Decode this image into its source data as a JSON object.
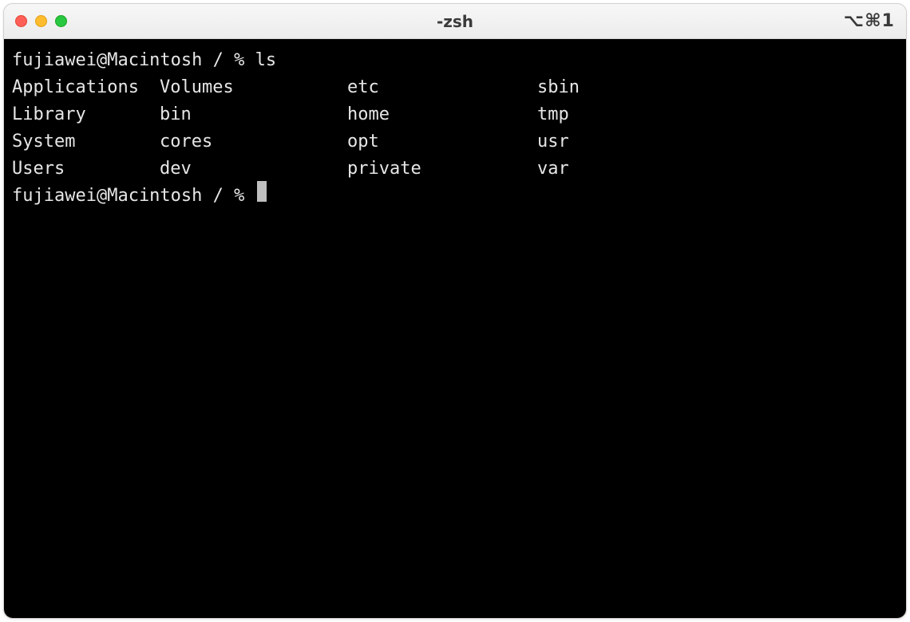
{
  "window": {
    "title": "-zsh",
    "shortcut_indicator": "⌥⌘1"
  },
  "terminal": {
    "prompt_1": "fujiawei@Macintosh / % ",
    "command_1": "ls",
    "ls_output": {
      "col1": [
        "Applications",
        "Library",
        "System",
        "Users"
      ],
      "col2": [
        "Volumes",
        "bin",
        "cores",
        "dev"
      ],
      "col3": [
        "etc",
        "home",
        "opt",
        "private"
      ],
      "col4": [
        "sbin",
        "tmp",
        "usr",
        "var"
      ]
    },
    "prompt_2": "fujiawei@Macintosh / % "
  }
}
